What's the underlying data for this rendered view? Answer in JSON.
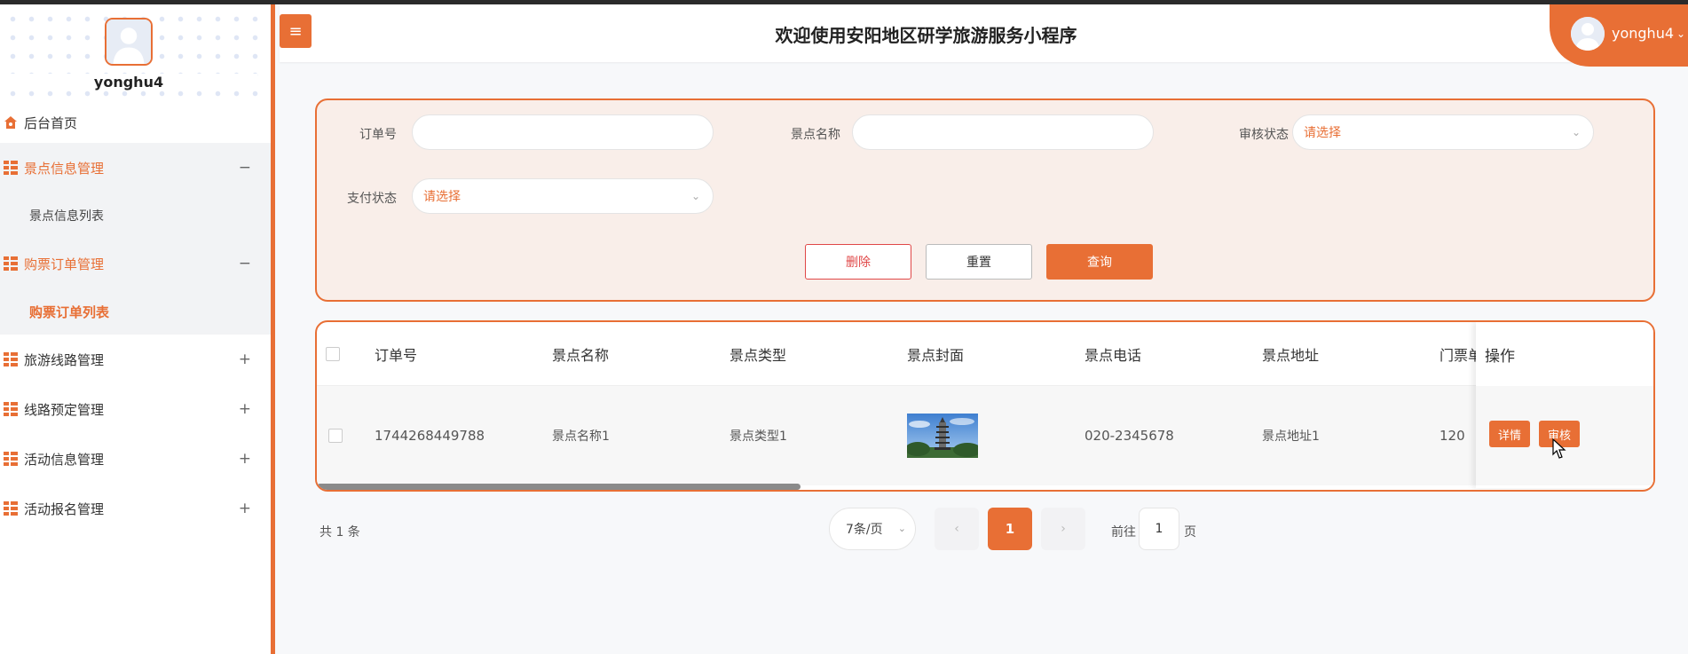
{
  "app": {
    "title": "欢迎使用安阳地区研学旅游服务小程序",
    "username": "yonghu4",
    "accent": "#e86f35"
  },
  "header": {
    "menu_toggle_icon": "≡",
    "user_caret": "⌄"
  },
  "sidebar": {
    "username": "yonghu4",
    "items": [
      {
        "label": "后台首页",
        "icon": "home-icon"
      },
      {
        "label": "景点信息管理",
        "icon": "grid-icon",
        "toggle": "−"
      },
      {
        "label": "景点信息列表"
      },
      {
        "label": "购票订单管理",
        "icon": "grid-icon",
        "toggle": "−"
      },
      {
        "label": "购票订单列表"
      },
      {
        "label": "旅游线路管理",
        "icon": "grid-icon",
        "toggle": "+"
      },
      {
        "label": "线路预定管理",
        "icon": "grid-icon",
        "toggle": "+"
      },
      {
        "label": "活动信息管理",
        "icon": "grid-icon",
        "toggle": "+"
      },
      {
        "label": "活动报名管理",
        "icon": "grid-icon",
        "toggle": "+"
      }
    ]
  },
  "search": {
    "order_no_label": "订单号",
    "order_no_value": "",
    "spot_name_label": "景点名称",
    "spot_name_value": "",
    "audit_label": "审核状态",
    "audit_placeholder": "请选择",
    "pay_label": "支付状态",
    "pay_placeholder": "请选择",
    "delete_label": "删除",
    "reset_label": "重置",
    "query_label": "查询"
  },
  "table": {
    "headers": [
      "订单号",
      "景点名称",
      "景点类型",
      "景点封面",
      "景点电话",
      "景点地址",
      "门票单"
    ],
    "ops_header": "操作",
    "rows": [
      {
        "order_no": "1744268449788",
        "spot_name": "景点名称1",
        "spot_type": "景点类型1",
        "phone": "020-2345678",
        "address": "景点地址1",
        "price": "120"
      }
    ],
    "detail_label": "详情",
    "audit_label": "审核"
  },
  "pagination": {
    "total": "共 1 条",
    "page_size": "7条/页",
    "prev": "‹",
    "current": "1",
    "next": "›",
    "goto_prefix": "前往",
    "goto_value": "1",
    "goto_suffix": "页"
  }
}
